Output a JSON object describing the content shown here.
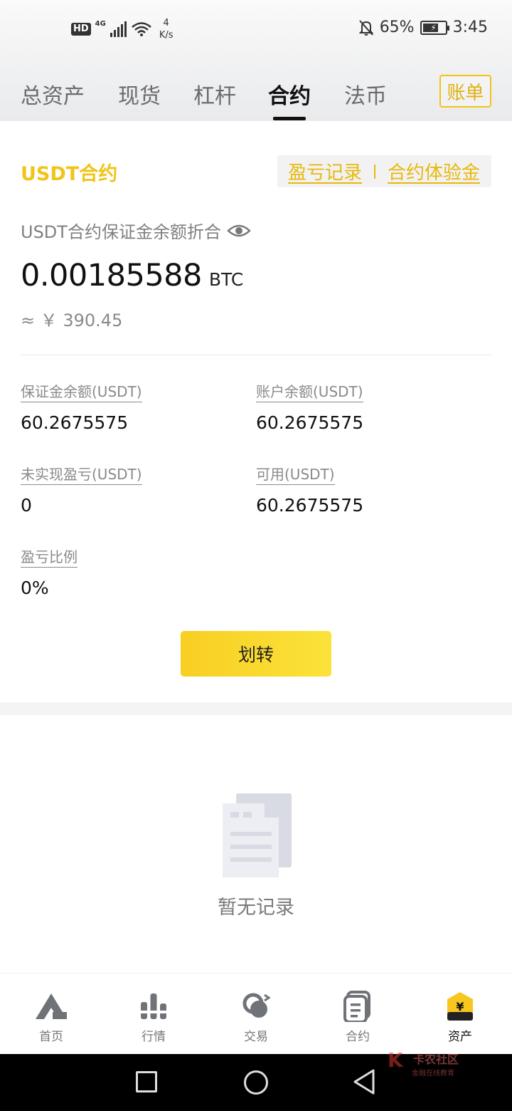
{
  "status_bar": {
    "hd": "HD",
    "network": "4G",
    "speed_value": "4",
    "speed_unit": "K/s",
    "battery": "65%",
    "time": "3:45"
  },
  "top_tabs": [
    {
      "label": "总资产",
      "active": false
    },
    {
      "label": "现货",
      "active": false
    },
    {
      "label": "杠杆",
      "active": false
    },
    {
      "label": "合约",
      "active": true
    },
    {
      "label": "法币",
      "active": false
    }
  ],
  "bill_button": "账单",
  "section": {
    "title": "USDT合约",
    "link_pnl": "盈亏记录",
    "link_trial": "合约体验金"
  },
  "balance": {
    "label": "USDT合约保证金余额折合",
    "value": "0.00185588",
    "unit": "BTC",
    "cny": "≈ ￥ 390.45"
  },
  "stats": [
    {
      "label": "保证金余额(USDT)",
      "value": "60.2675575"
    },
    {
      "label": "账户余额(USDT)",
      "value": "60.2675575"
    },
    {
      "label": "未实现盈亏(USDT)",
      "value": "0"
    },
    {
      "label": "可用(USDT)",
      "value": "60.2675575"
    },
    {
      "label": "盈亏比例",
      "value": "0%"
    }
  ],
  "transfer_button": "划转",
  "empty_state": "暂无记录",
  "bottom_nav": [
    {
      "label": "首页",
      "icon": "home-icon",
      "active": false
    },
    {
      "label": "行情",
      "icon": "market-icon",
      "active": false
    },
    {
      "label": "交易",
      "icon": "trade-icon",
      "active": false
    },
    {
      "label": "合约",
      "icon": "contract-icon",
      "active": false
    },
    {
      "label": "资产",
      "icon": "assets-icon",
      "active": true
    }
  ],
  "watermark": {
    "title": "卡农社区",
    "subtitle": "金融在线教育"
  },
  "colors": {
    "accent": "#f0c419",
    "link": "#e8b80e",
    "text": "#111111",
    "muted": "#8a8a8a"
  }
}
